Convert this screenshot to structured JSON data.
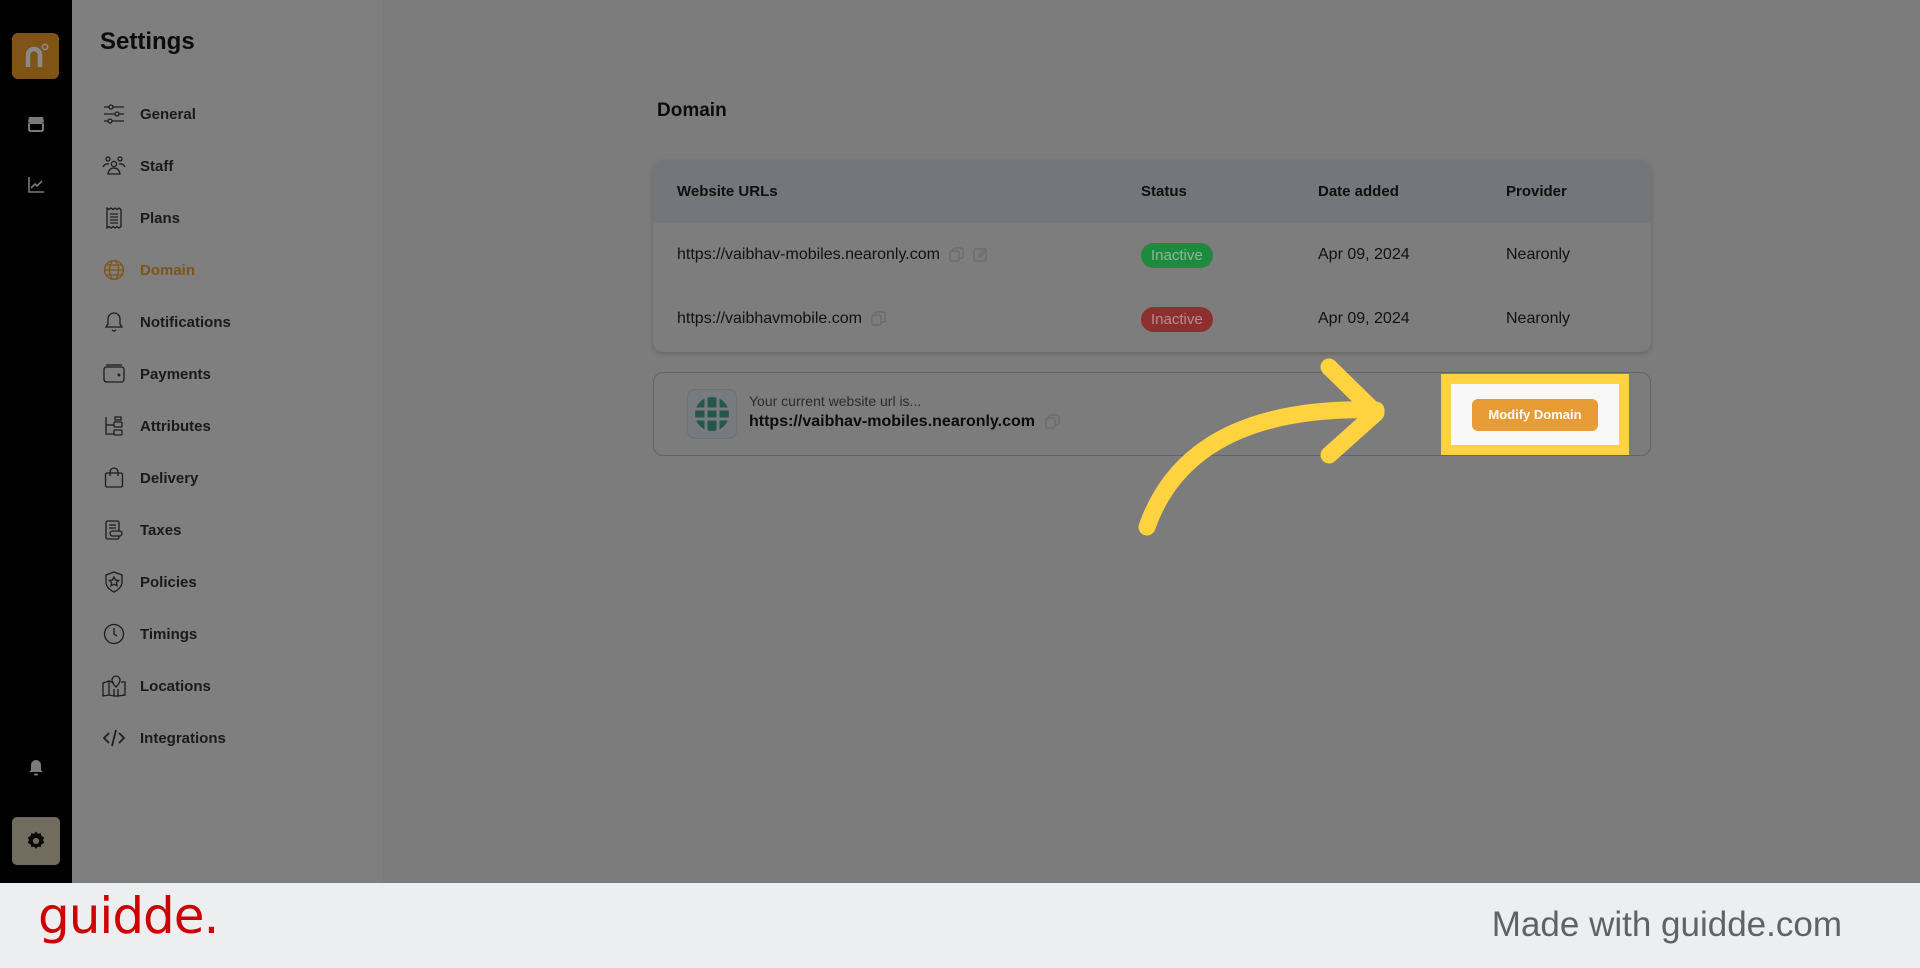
{
  "rail": {
    "logo_glyph": "n°",
    "items": [
      "store-icon",
      "analytics-icon"
    ],
    "bottom_items": [
      "bell-icon",
      "gear-icon"
    ]
  },
  "sidebar": {
    "title": "Settings",
    "items": [
      {
        "label": "General",
        "icon": "sliders-icon",
        "active": false
      },
      {
        "label": "Staff",
        "icon": "users-icon",
        "active": false
      },
      {
        "label": "Plans",
        "icon": "receipt-icon",
        "active": false
      },
      {
        "label": "Domain",
        "icon": "globe-icon",
        "active": true
      },
      {
        "label": "Notifications",
        "icon": "bell-icon",
        "active": false
      },
      {
        "label": "Payments",
        "icon": "wallet-icon",
        "active": false
      },
      {
        "label": "Attributes",
        "icon": "hierarchy-icon",
        "active": false
      },
      {
        "label": "Delivery",
        "icon": "bag-icon",
        "active": false
      },
      {
        "label": "Taxes",
        "icon": "tax-icon",
        "active": false
      },
      {
        "label": "Policies",
        "icon": "shield-star-icon",
        "active": false
      },
      {
        "label": "Timings",
        "icon": "clock-icon",
        "active": false
      },
      {
        "label": "Locations",
        "icon": "map-icon",
        "active": false
      },
      {
        "label": "Integrations",
        "icon": "code-icon",
        "active": false
      }
    ],
    "accent_color": "#e79c36"
  },
  "main": {
    "title": "Domain",
    "table": {
      "headers": [
        "Website URLs",
        "Status",
        "Date added",
        "Provider"
      ],
      "rows": [
        {
          "url": "https://vaibhav-mobiles.nearonly.com",
          "status": "Inactive",
          "status_color": "green",
          "date": "Apr 09, 2024",
          "provider": "Nearonly",
          "actions": [
            "copy-icon",
            "edit-icon"
          ]
        },
        {
          "url": "https://vaibhavmobile.com",
          "status": "Inactive",
          "status_color": "red",
          "date": "Apr 09, 2024",
          "provider": "Nearonly",
          "actions": [
            "copy-icon"
          ]
        }
      ]
    },
    "current_url": {
      "label": "Your current website url is...",
      "value": "https://vaibhav-mobiles.nearonly.com"
    },
    "modify_button": "Modify Domain"
  },
  "footer": {
    "brand": "guidde.",
    "tagline": "Made with guidde.com"
  }
}
